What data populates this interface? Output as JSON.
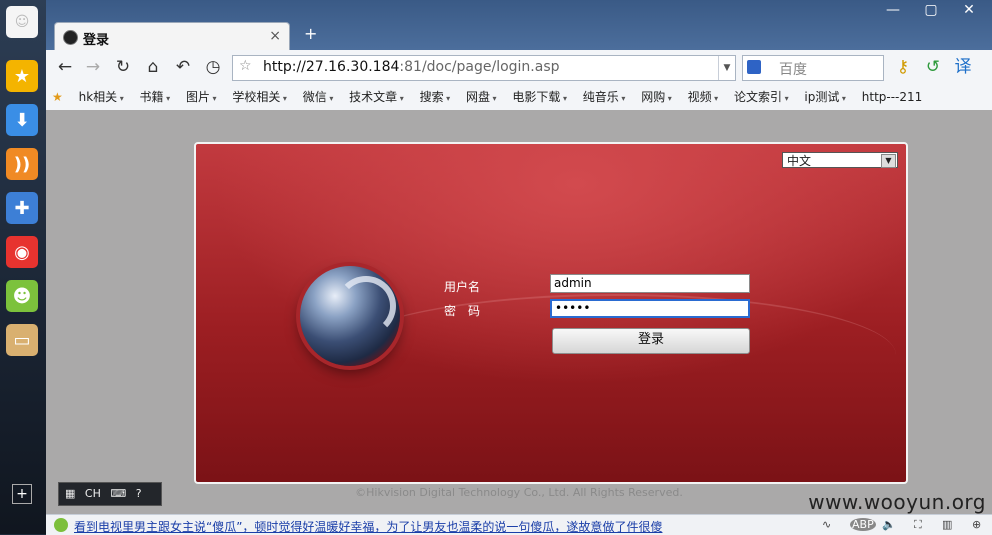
{
  "dock": {
    "items": [
      "smiley-icon",
      "star-icon",
      "download-icon",
      "rss-icon",
      "gamepad-icon",
      "weibo-icon",
      "emoji-icon",
      "note-icon"
    ],
    "add": "+"
  },
  "tab": {
    "title": "登录",
    "close": "×",
    "new_tab": "+"
  },
  "toolbar": {
    "url_host": "http://27.16.30.184",
    "url_rest": ":81/doc/page/login.asp",
    "search_placeholder": "百度"
  },
  "bookmarks": [
    "hk相关",
    "书籍",
    "图片",
    "学校相关",
    "微信",
    "技术文章",
    "搜索",
    "网盘",
    "电影下载",
    "纯音乐",
    "网购",
    "视频",
    "论文索引",
    "ip测试"
  ],
  "bookmark_last": "http---211",
  "login": {
    "language": "中文",
    "username_label": "用户名",
    "password_label": "密　码",
    "username_value": "admin",
    "password_value": "•••••",
    "submit_label": "登录"
  },
  "footer": {
    "copyright": "©Hikvision Digital Technology Co., Ltd. All Rights Reserved."
  },
  "ime": {
    "label": "CH"
  },
  "watermark": "www.wooyun.org",
  "status": {
    "news": "看到电视里男主跟女主说“傻瓜”，顿时觉得好温暖好幸福，为了让男友也温柔的说一句傻瓜，遂故意做了件很傻"
  },
  "colors": {
    "panel": "#b8262b",
    "page_bg": "#aaa9a9",
    "focus": "#2a6bd1"
  }
}
